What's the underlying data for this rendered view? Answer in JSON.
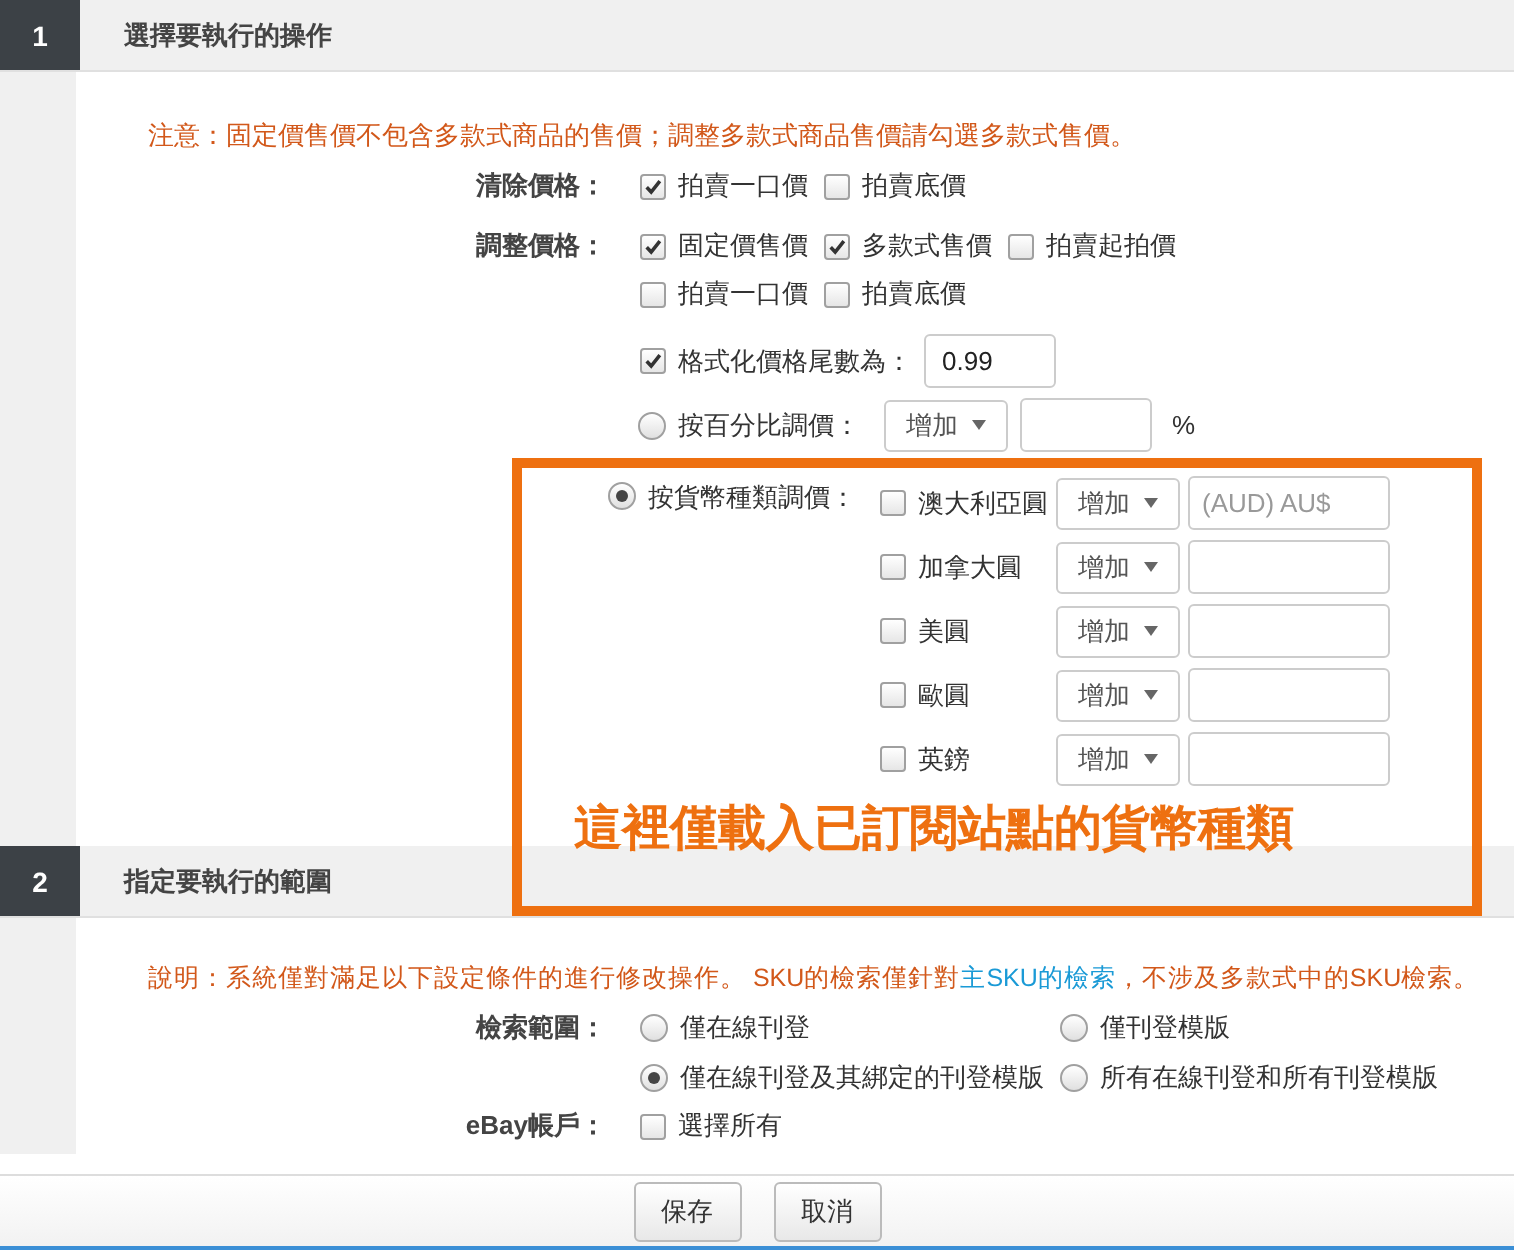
{
  "section1": {
    "number": "1",
    "title": "選擇要執行的操作",
    "notice": "注意：固定價售價不包含多款式商品的售價；調整多款式商品售價請勾選多款式售價。",
    "clear_price": {
      "label": "清除價格：",
      "options": [
        {
          "label": "拍賣一口價",
          "checked": true
        },
        {
          "label": "拍賣底價",
          "checked": false
        }
      ]
    },
    "adjust_price": {
      "label": "調整價格：",
      "rows": [
        [
          {
            "label": "固定價售價",
            "checked": true
          },
          {
            "label": "多款式售價",
            "checked": true
          },
          {
            "label": "拍賣起拍價",
            "checked": false
          }
        ],
        [
          {
            "label": "拍賣一口價",
            "checked": false
          },
          {
            "label": "拍賣底價",
            "checked": false
          }
        ]
      ]
    },
    "format_tail": {
      "label": "格式化價格尾數為：",
      "checked": true,
      "value": "0.99"
    },
    "percent": {
      "label": "按百分比調價：",
      "selected": false,
      "direction": "增加",
      "unit": "%"
    },
    "currency": {
      "label": "按貨幣種類調價：",
      "selected": true,
      "rows": [
        {
          "name": "澳大利亞圓",
          "checked": false,
          "direction": "增加",
          "placeholder": "(AUD) AU$"
        },
        {
          "name": "加拿大圓",
          "checked": false,
          "direction": "增加"
        },
        {
          "name": "美圓",
          "checked": false,
          "direction": "增加"
        },
        {
          "name": "歐圓",
          "checked": false,
          "direction": "增加"
        },
        {
          "name": "英鎊",
          "checked": false,
          "direction": "增加"
        }
      ]
    }
  },
  "annotation": {
    "text": "這裡僅載入已訂閱站點的貨幣種類"
  },
  "section2": {
    "number": "2",
    "title": "指定要執行的範圍",
    "note": [
      {
        "kind": "plain",
        "text": "說明：系統僅對滿足以下設定條件的進行修改操作。 SKU的檢索僅針對"
      },
      {
        "kind": "link",
        "text": "主SKU的檢索"
      },
      {
        "kind": "plain",
        "text": "，不涉及多款式中的SKU檢索。"
      }
    ],
    "search_scope": {
      "label": "檢索範圍：",
      "options": [
        {
          "label": "僅在線刊登",
          "selected": false
        },
        {
          "label": "僅刊登模版",
          "selected": false
        },
        {
          "label": "僅在線刊登及其綁定的刊登模版",
          "selected": true
        },
        {
          "label": "所有在線刊登和所有刊登模版",
          "selected": false
        }
      ]
    },
    "account": {
      "label": "eBay帳戶：",
      "options": [
        {
          "label": "選擇所有",
          "checked": false
        }
      ]
    }
  },
  "footer": {
    "buttons": [
      "保存",
      "取消"
    ]
  }
}
